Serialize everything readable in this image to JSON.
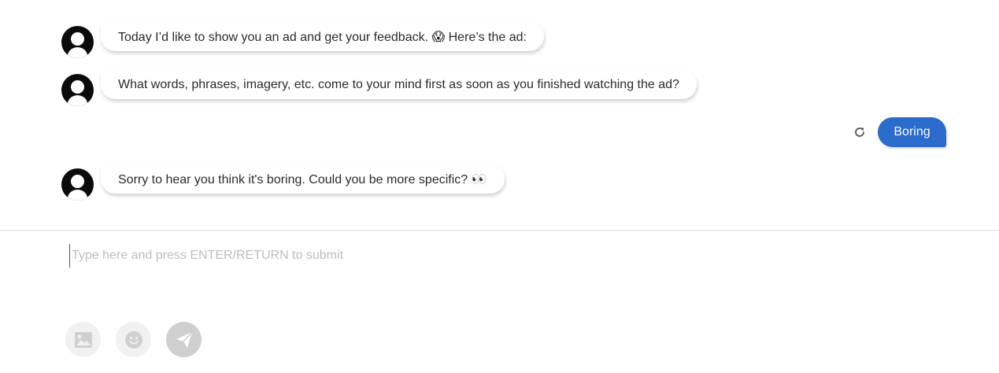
{
  "messages": [
    {
      "role": "bot",
      "text": "Today I’d like to show you an ad and get your feedback.",
      "emoji": "😱",
      "text_after": "Here’s the ad:"
    },
    {
      "role": "bot",
      "text": "What words, phrases, imagery, etc. come to your mind first as soon as you finished watching the ad?"
    },
    {
      "role": "user",
      "text": "Boring"
    },
    {
      "role": "bot",
      "text": "Sorry to hear you think it's boring. Could you be more specific?",
      "emoji": "👀"
    }
  ],
  "composer": {
    "placeholder": "Type here and press ENTER/RETURN to submit",
    "value": "",
    "tools": [
      "image-icon",
      "emoji-icon",
      "send-icon"
    ]
  },
  "colors": {
    "user_bubble": "#2a6bcc",
    "avatar": "#0b0b0b",
    "placeholder": "#bdbdbd"
  },
  "icons": {
    "retry": "refresh-icon"
  }
}
